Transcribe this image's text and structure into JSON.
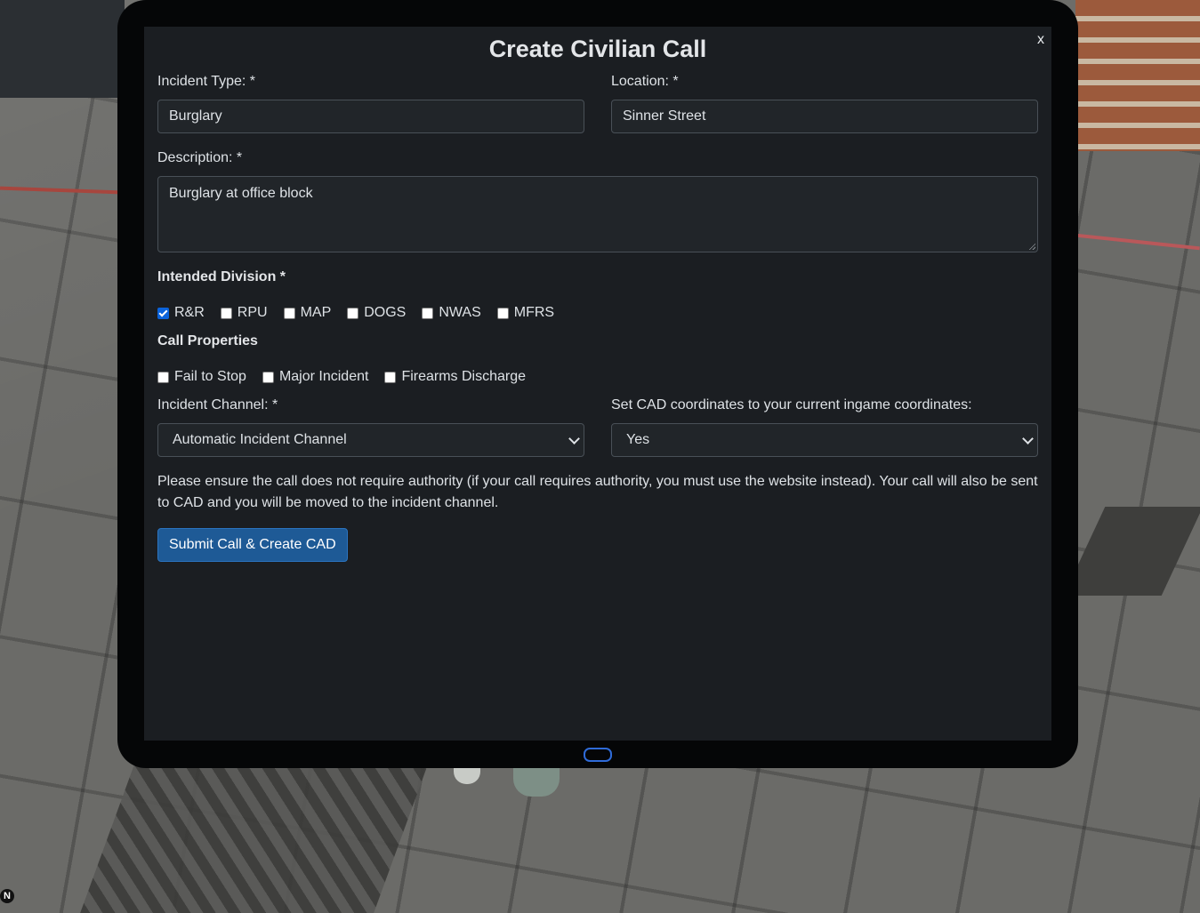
{
  "modal": {
    "title": "Create Civilian Call",
    "close_label": "x"
  },
  "form": {
    "incident_type": {
      "label": "Incident Type: *",
      "value": "Burglary"
    },
    "location": {
      "label": "Location: *",
      "value": "Sinner Street"
    },
    "description": {
      "label": "Description: *",
      "value": "Burglary at office block"
    },
    "intended_division": {
      "heading": "Intended Division *",
      "options": [
        {
          "label": "R&R",
          "checked": true
        },
        {
          "label": "RPU",
          "checked": false
        },
        {
          "label": "MAP",
          "checked": false
        },
        {
          "label": "DOGS",
          "checked": false
        },
        {
          "label": "NWAS",
          "checked": false
        },
        {
          "label": "MFRS",
          "checked": false
        }
      ]
    },
    "call_properties": {
      "heading": "Call Properties",
      "options": [
        {
          "label": "Fail to Stop",
          "checked": false
        },
        {
          "label": "Major Incident",
          "checked": false
        },
        {
          "label": "Firearms Discharge",
          "checked": false
        }
      ]
    },
    "incident_channel": {
      "label": "Incident Channel: *",
      "selected": "Automatic Incident Channel"
    },
    "cad_coords": {
      "label": "Set CAD coordinates to your current ingame coordinates:",
      "selected": "Yes"
    },
    "notice": "Please ensure the call does not require authority (if your call requires authority, you must use the website instead). Your call will also be sent to CAD and you will be moved to the incident channel.",
    "submit_label": "Submit Call & Create CAD"
  },
  "corner_badge": "N",
  "colors": {
    "screen_bg": "#1b1e22",
    "submit_bg": "#1e5a96",
    "checkbox_checked": "#0b63db",
    "home_button": "#2f6bd8"
  }
}
